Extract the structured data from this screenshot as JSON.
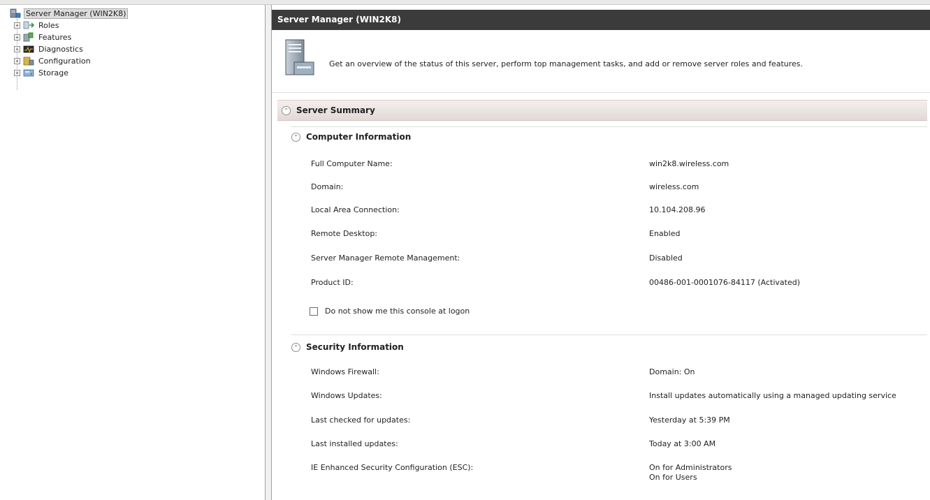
{
  "tree": {
    "root": {
      "label": "Server Manager (WIN2K8)",
      "icon": "server-manager-icon"
    },
    "children": [
      {
        "label": "Roles",
        "icon": "roles-icon",
        "expander": "+"
      },
      {
        "label": "Features",
        "icon": "features-icon",
        "expander": "+"
      },
      {
        "label": "Diagnostics",
        "icon": "diagnostics-icon",
        "expander": "+"
      },
      {
        "label": "Configuration",
        "icon": "configuration-icon",
        "expander": "+"
      },
      {
        "label": "Storage",
        "icon": "storage-icon",
        "expander": "+"
      }
    ]
  },
  "main": {
    "title": "Server Manager (WIN2K8)",
    "overview": "Get an overview of the status of this server, perform top management tasks, and add or remove server roles and features.",
    "server_summary": {
      "title": "Server Summary",
      "computer_information": {
        "title": "Computer Information",
        "rows": [
          {
            "label": "Full Computer Name:",
            "value": "win2k8.wireless.com"
          },
          {
            "label": "Domain:",
            "value": "wireless.com"
          },
          {
            "label": "Local Area Connection:",
            "value": "10.104.208.96"
          },
          {
            "label": "Remote Desktop:",
            "value": "Enabled"
          },
          {
            "label": "Server Manager Remote Management:",
            "value": "Disabled"
          },
          {
            "label": "Product ID:",
            "value": "00486-001-0001076-84117 (Activated)"
          }
        ],
        "checkbox_label": "Do not show me this console at logon"
      },
      "security_information": {
        "title": "Security Information",
        "rows": [
          {
            "label": "Windows Firewall:",
            "value": "Domain: On"
          },
          {
            "label": "Windows Updates:",
            "value": "Install updates automatically using a managed updating service"
          },
          {
            "label": "Last checked for updates:",
            "value": "Yesterday at 5:39 PM"
          },
          {
            "label": "Last installed updates:",
            "value": "Today at 3:00 AM"
          },
          {
            "label": "IE Enhanced Security Configuration (ESC):",
            "value": "On for Administrators",
            "value2": "On for Users"
          }
        ]
      }
    }
  },
  "colors": {
    "title_bar": "#3b3b3b",
    "section_header": "#e3d9d6"
  }
}
